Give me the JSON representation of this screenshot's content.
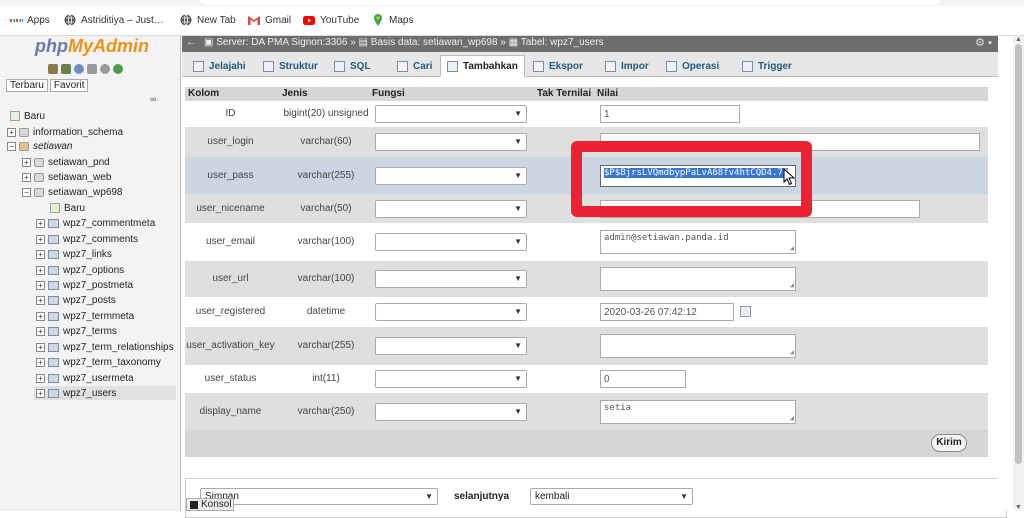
{
  "bookmarks": [
    {
      "label": "Apps",
      "icon": "apps-grid-icon"
    },
    {
      "label": "Astriditiya – Just…",
      "icon": "globe-icon"
    },
    {
      "label": "New Tab",
      "icon": "globe-icon"
    },
    {
      "label": "Gmail",
      "icon": "gmail-icon"
    },
    {
      "label": "YouTube",
      "icon": "youtube-icon"
    },
    {
      "label": "Maps",
      "icon": "maps-pin-icon"
    }
  ],
  "sidebar": {
    "logo_php": "php",
    "logo_myadmin": "MyAdmin",
    "recent_tab": "Terbaru",
    "favorite_tab": "Favorit",
    "tree": {
      "new_root": "Baru",
      "db_information_schema": "information_schema",
      "db_setiawan": "setiawan",
      "db_setiawan_pnd": "setiawan_pnd",
      "db_setiawan_web": "setiawan_web",
      "db_setiawan_wp698": "setiawan_wp698",
      "new_table": "Baru",
      "tables": [
        "wpz7_commentmeta",
        "wpz7_comments",
        "wpz7_links",
        "wpz7_options",
        "wpz7_postmeta",
        "wpz7_posts",
        "wpz7_termmeta",
        "wpz7_terms",
        "wpz7_term_relationships",
        "wpz7_term_taxonomy",
        "wpz7_usermeta",
        "wpz7_users"
      ]
    }
  },
  "breadcrumb": {
    "server": "Server: DA PMA Signon:3306",
    "database": "Basis data: setiawan_wp698",
    "table": "Tabel: wpz7_users",
    "separator": "»"
  },
  "tabs": [
    "Jelajahi",
    "Struktur",
    "SQL",
    "Cari",
    "Tambahkan",
    "Ekspor",
    "Impor",
    "Operasi",
    "Trigger"
  ],
  "active_tab": "Tambahkan",
  "table_header": {
    "column": "Kolom",
    "type": "Jenis",
    "function": "Fungsi",
    "null": "Tak Ternilai",
    "value": "Nilai"
  },
  "rows": [
    {
      "name": "ID",
      "type": "bigint(20) unsigned",
      "value": "1"
    },
    {
      "name": "user_login",
      "type": "varchar(60)",
      "value": ""
    },
    {
      "name": "user_pass",
      "type": "varchar(255)",
      "value": "$P$BjrsLVQmdbypPaLvA68fv4htCQD4.70"
    },
    {
      "name": "user_nicename",
      "type": "varchar(50)",
      "value": ""
    },
    {
      "name": "user_email",
      "type": "varchar(100)",
      "value": "admin@setiawan.panda.id"
    },
    {
      "name": "user_url",
      "type": "varchar(100)",
      "value": ""
    },
    {
      "name": "user_registered",
      "type": "datetime",
      "value": "2020-03-26 07:42:12"
    },
    {
      "name": "user_activation_key",
      "type": "varchar(255)",
      "value": ""
    },
    {
      "name": "user_status",
      "type": "int(11)",
      "value": "0"
    },
    {
      "name": "display_name",
      "type": "varchar(250)",
      "value": "setia"
    }
  ],
  "submit_label": "Kirim",
  "bottom": {
    "action_select": "Simpan",
    "then_label": "selanjutnya",
    "then_select": "kembali"
  },
  "console_label": "Konsol",
  "colors": {
    "highlight_box": "#ec2232",
    "selection": "#3875d7",
    "link": "#235a81"
  }
}
